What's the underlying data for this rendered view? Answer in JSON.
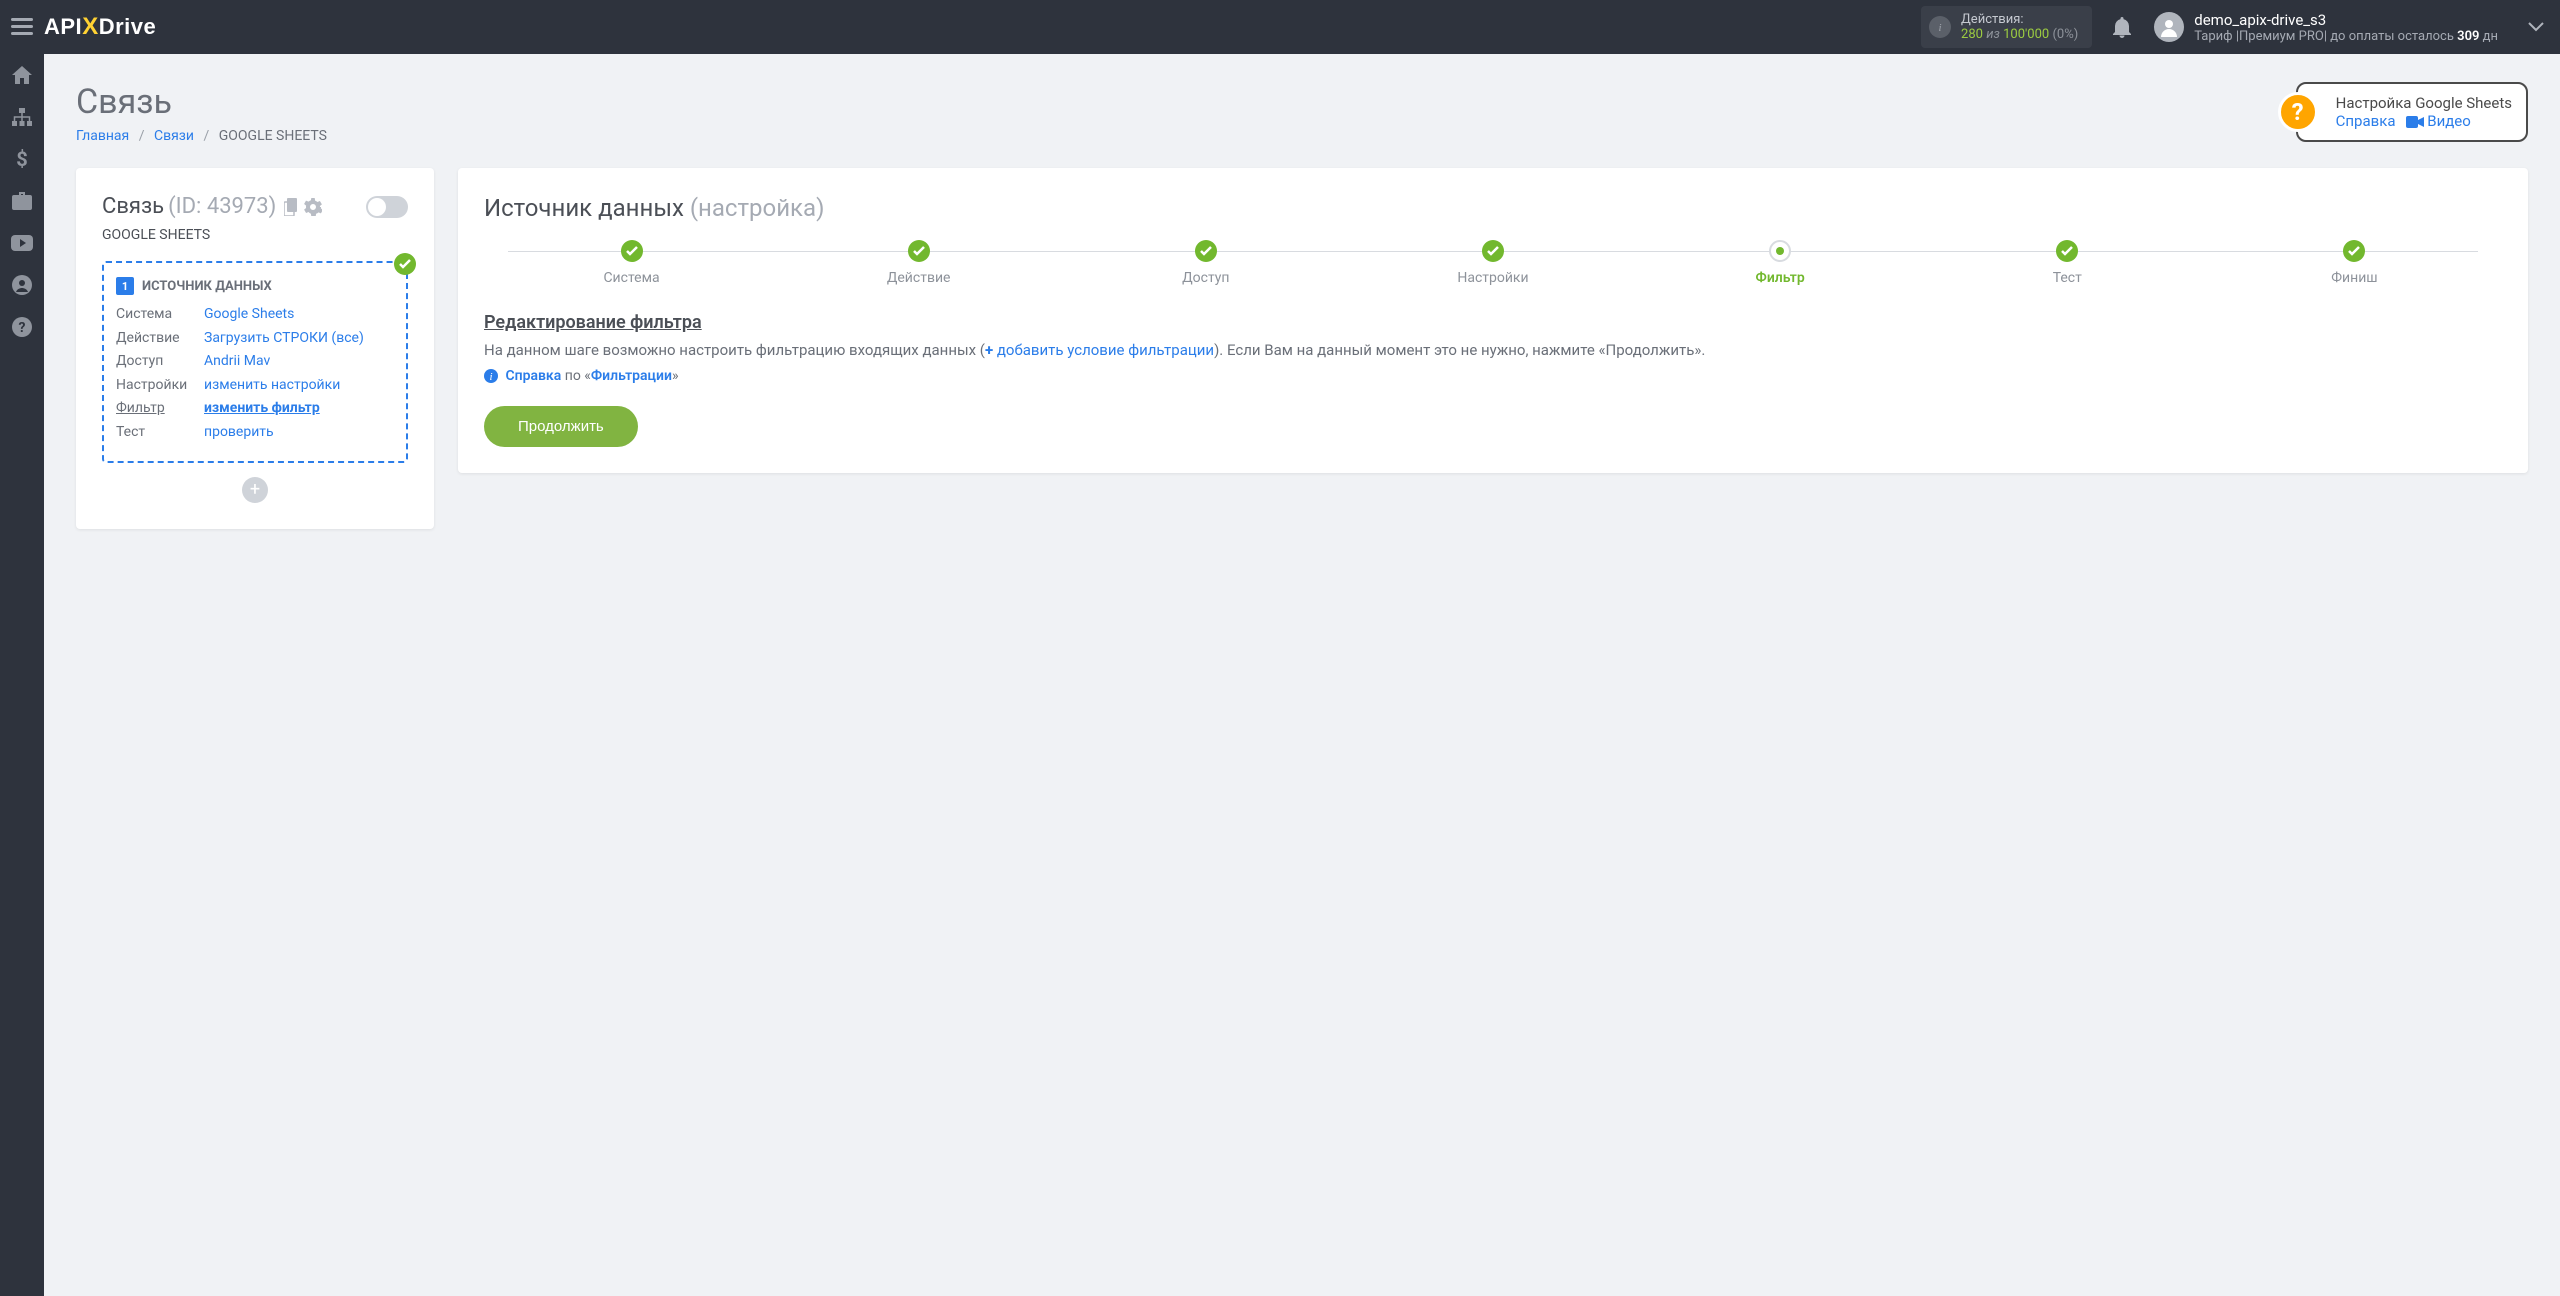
{
  "topbar": {
    "logo": {
      "api": "API",
      "x": "X",
      "drive": "Drive"
    },
    "actions": {
      "label": "Действия:",
      "used": "280",
      "of": "из",
      "total": "100'000",
      "pct": "(0%)"
    },
    "user": {
      "name": "demo_apix-drive_s3",
      "plan_prefix": "Тариф |",
      "plan_name": "Премиум PRO",
      "plan_mid": "|  до оплаты осталось ",
      "days": "309",
      "days_unit": " дн"
    }
  },
  "page": {
    "title": "Связь",
    "breadcrumb": {
      "home": "Главная",
      "links": "Связи",
      "current": "GOOGLE SHEETS"
    },
    "help": {
      "title": "Настройка Google Sheets",
      "ref": "Справка",
      "video": "Видео"
    }
  },
  "left": {
    "conn_label": "Связь",
    "conn_id_label": "(ID: 43973)",
    "conn_sub": "GOOGLE SHEETS",
    "source_title": "ИСТОЧНИК ДАННЫХ",
    "rows": [
      {
        "k": "Система",
        "v": "Google Sheets",
        "active": false
      },
      {
        "k": "Действие",
        "v": "Загрузить СТРОКИ (все)",
        "active": false
      },
      {
        "k": "Доступ",
        "v": "Andrii Mav",
        "active": false
      },
      {
        "k": "Настройки",
        "v": "изменить настройки",
        "active": false
      },
      {
        "k": "Фильтр",
        "v": "изменить фильтр",
        "active": true
      },
      {
        "k": "Тест",
        "v": "проверить",
        "active": false
      }
    ]
  },
  "right": {
    "title_main": "Источник данных",
    "title_sub": "(настройка)",
    "steps": [
      {
        "label": "Система",
        "state": "done"
      },
      {
        "label": "Действие",
        "state": "done"
      },
      {
        "label": "Доступ",
        "state": "done"
      },
      {
        "label": "Настройки",
        "state": "done"
      },
      {
        "label": "Фильтр",
        "state": "current"
      },
      {
        "label": "Тест",
        "state": "done"
      },
      {
        "label": "Финиш",
        "state": "done"
      }
    ],
    "section_title": "Редактирование фильтра",
    "desc_p1": "На данном шаге возможно настроить фильтрацию входящих данных (",
    "desc_link": "добавить условие фильтрации",
    "desc_p2": "). Если Вам на данный момент это не нужно, нажмите «Продолжить».",
    "help_line_pre": "Справка",
    "help_line_mid": " по «",
    "help_line_link": "Фильтрации",
    "help_line_end": "»",
    "continue": "Продолжить"
  }
}
